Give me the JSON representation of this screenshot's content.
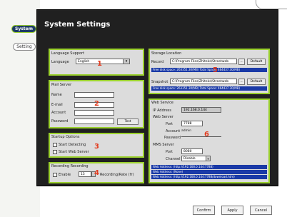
{
  "sidebar": {
    "items": [
      {
        "label": "System"
      },
      {
        "label": "Setting"
      }
    ]
  },
  "window": {
    "title": "System Settings"
  },
  "language": {
    "title": "Language Support",
    "label": "Language",
    "value": "English"
  },
  "mail": {
    "title": "Mail Server",
    "fields": [
      {
        "label": "Name"
      },
      {
        "label": "E-mail"
      },
      {
        "label": "Account"
      },
      {
        "label": "Password"
      }
    ],
    "test_label": "Test"
  },
  "startup": {
    "title": "Startup Options",
    "options": [
      {
        "label": "Start Detecting"
      },
      {
        "label": "Start Web Server"
      }
    ]
  },
  "recording": {
    "title": "Recording Recording",
    "enable_label": "Enable",
    "value": "15",
    "suffix": "Recording/Rate (fr)"
  },
  "storage": {
    "title": "Storage Location",
    "record_label": "Record",
    "record_path": "C:\\Program Files\\Zhiteks\\Streetweb",
    "default_label": "Default",
    "record_info": "Free disk space: 263351.30(MB) Total Space: 464437.30(MB)",
    "snapshot_label": "Snapshot",
    "snapshot_path": "C:\\Program Files\\Zhiteks\\Streetweb",
    "snapshot_info": "Free disk space: 263351.30(MB) Total Space: 464437.30(MB)"
  },
  "web": {
    "title": "Web Service",
    "ip_label": "IP Address",
    "ip_value": "192.168.0.144",
    "server_label": "Web Server",
    "port_label": "Port",
    "port_value": "7788",
    "account_label": "Account",
    "account_value": "admin",
    "password_label": "Password",
    "mms_label": "MMS Server",
    "mms_port_label": "Port",
    "mms_port_value": "8080",
    "channel_label": "Channel",
    "channel_value": "Disable",
    "addresses": [
      "Web Address: (http://192.168.0.144:7788)",
      "Web Address: (None)",
      "Web Address: (http://192.168.0.144:7788/download.htm)"
    ]
  },
  "markers": [
    "1",
    "2",
    "3",
    "4",
    "5",
    "6"
  ],
  "footer": {
    "confirm": "Confirm",
    "apply": "Apply",
    "cancel": "Cancel"
  },
  "colors": {
    "accent": "#9bd12e",
    "window_bg": "#202020",
    "highlight_blue": "#1a3aa7",
    "marker_red": "#e23b1e"
  }
}
